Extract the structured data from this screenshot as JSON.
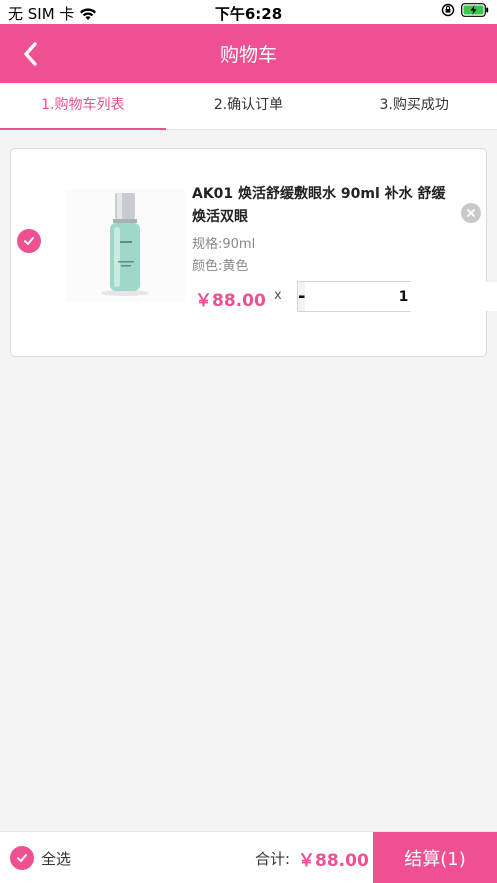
{
  "status_bar": {
    "carrier": "无 SIM 卡",
    "time": "下午6:28",
    "wifi_icon": "wifi-icon",
    "lock_icon": "orientation-lock-icon",
    "battery_icon": "battery-charging-icon"
  },
  "nav": {
    "title": "购物车",
    "back_icon": "chevron-left-icon"
  },
  "steps": [
    {
      "label": "1.购物车列表",
      "active": true
    },
    {
      "label": "2.确认订单",
      "active": false
    },
    {
      "label": "3.购买成功",
      "active": false
    }
  ],
  "cart": {
    "items": [
      {
        "checked": true,
        "title": "AK01 焕活舒缓敷眼水 90ml 补水 舒缓焕活双眼",
        "spec": "规格:90ml",
        "color": "颜色:黄色",
        "price": "￥88.00",
        "times": "x",
        "quantity": "1",
        "minus_label": "-",
        "plus_label": "+"
      }
    ]
  },
  "footer": {
    "select_all_label": "全选",
    "total_label": "合计:",
    "total_value": "￥88.00",
    "checkout_label": "结算(1)"
  },
  "colors": {
    "accent": "#ee5092",
    "background": "#f4f4f4"
  }
}
